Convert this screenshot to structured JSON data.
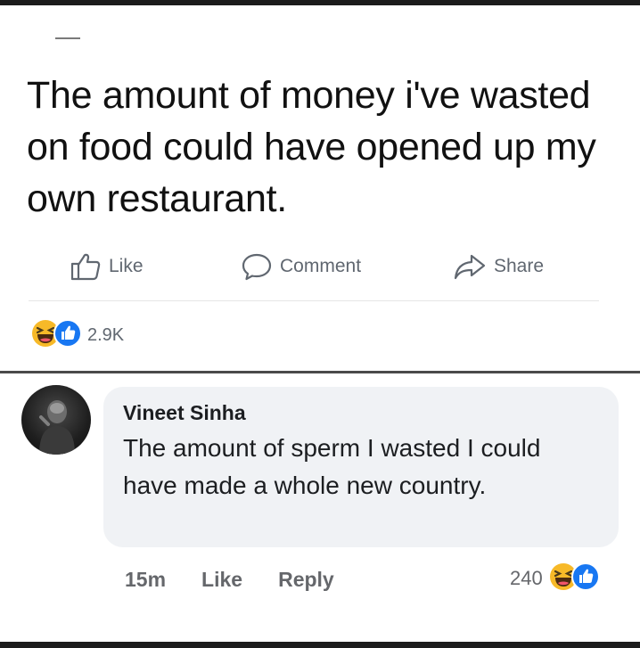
{
  "post": {
    "text": "The amount of money i've wasted on food could have opened up my own restaurant."
  },
  "actions": {
    "like_label": "Like",
    "comment_label": "Comment",
    "share_label": "Share"
  },
  "post_reactions": {
    "count": "2.9K",
    "icons": [
      "haha-icon",
      "like-icon"
    ]
  },
  "comment": {
    "author": "Vineet Sinha",
    "text": "The amount of sperm I wasted I could have made a whole new country.",
    "time": "15m",
    "like_label": "Like",
    "reply_label": "Reply",
    "reaction_count": "240",
    "reaction_icons": [
      "haha-icon",
      "like-icon"
    ]
  },
  "colors": {
    "like_blue": "#1877f2",
    "haha_yellow": "#f7b928",
    "bubble_bg": "#f0f2f5",
    "meta_gray": "#65676b"
  }
}
